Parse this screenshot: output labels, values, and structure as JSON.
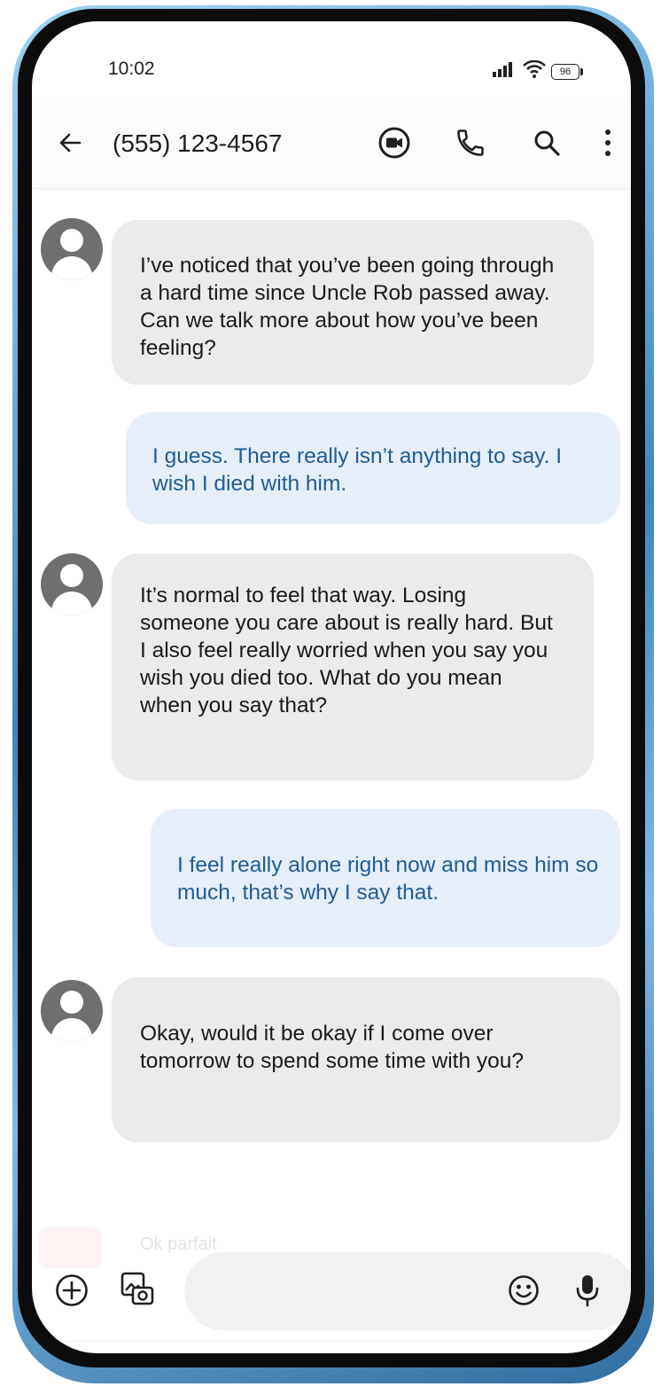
{
  "status_bar": {
    "time": "10:02",
    "battery": "96"
  },
  "header": {
    "contact": "(555) 123-4567"
  },
  "messages": [
    {
      "direction": "in",
      "text": "I’ve noticed that you’ve been going through a hard time since Uncle Rob passed away. Can we talk more about how you’ve been feeling?"
    },
    {
      "direction": "out",
      "text": "I guess. There really isn’t anything to say. I wish I died with him."
    },
    {
      "direction": "in",
      "text": "It’s normal to feel that way. Losing someone you care about is really hard. But I also feel really worried when you say you wish you died too. What do you mean when you say that?"
    },
    {
      "direction": "out",
      "text": "I feel really alone right now and miss him so much, that’s why I say that."
    },
    {
      "direction": "in",
      "text": "Okay, would it be okay if I come over tomorrow to spend some time with you?"
    }
  ],
  "composer": {
    "faded_preview": "Ok parfait"
  },
  "icons": {
    "back": "arrow-left-icon",
    "video": "video-call-icon",
    "call": "phone-icon",
    "search": "search-icon",
    "more": "more-vert-icon",
    "add": "add-circle-icon",
    "gallery": "gallery-camera-icon",
    "emoji": "emoji-icon",
    "mic": "mic-icon"
  },
  "colors": {
    "incoming_bubble": "#ebebeb",
    "outgoing_bubble": "#e6eef9",
    "outgoing_text": "#1f5c96",
    "frame_accent": "#3d87bf"
  }
}
